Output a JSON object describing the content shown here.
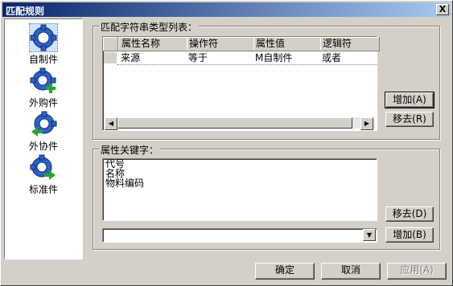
{
  "window": {
    "title": "匹配规则",
    "close_label": "X"
  },
  "sidebar": {
    "items": [
      {
        "label": "自制件",
        "icon": "gear-icon"
      },
      {
        "label": "外购件",
        "icon": "gear-plus-icon"
      },
      {
        "label": "外协件",
        "icon": "gear-arrow-left-icon"
      },
      {
        "label": "标准件",
        "icon": "gear-arrow-right-icon"
      }
    ]
  },
  "type_list": {
    "group_label": "匹配字符串类型列表：",
    "columns": [
      "属性名称",
      "操作符",
      "属性值",
      "逻辑符"
    ],
    "rows": [
      [
        "来源",
        "等于",
        "M自制件",
        "或者"
      ]
    ],
    "add_button": "增加(A)",
    "remove_button": "移去(R)"
  },
  "keywords": {
    "group_label": "属性关键字：",
    "items": [
      "代号",
      "名称",
      "物料编码"
    ],
    "remove_button": "移去(D)",
    "add_button": "增加(B)",
    "combo_value": ""
  },
  "footer": {
    "ok": "确定",
    "cancel": "取消",
    "apply": "应用(A)"
  }
}
